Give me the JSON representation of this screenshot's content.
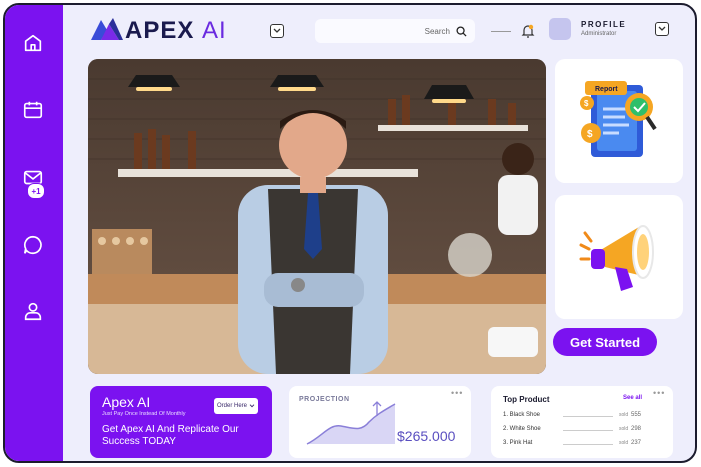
{
  "brand": {
    "name": "APEX",
    "suffix": "AI"
  },
  "header": {
    "search_placeholder": "Search",
    "profile_name": "PROFILE",
    "profile_role": "Administrator"
  },
  "sidebar": {
    "items": [
      {
        "name": "home",
        "icon": "home-icon"
      },
      {
        "name": "calendar",
        "icon": "calendar-icon"
      },
      {
        "name": "messages",
        "icon": "mail-icon",
        "badge": "+1"
      },
      {
        "name": "chat",
        "icon": "chat-icon"
      },
      {
        "name": "user",
        "icon": "user-icon"
      }
    ]
  },
  "cta": {
    "get_started": "Get Started"
  },
  "promo": {
    "title": "Apex AI",
    "subtitle": "Just Pay Once Instead Of Monthly",
    "order_button": "Order Here",
    "cta_text": "Get Apex AI And Replicate Our Success TODAY"
  },
  "projection": {
    "label": "PROJECTION",
    "value": "$265.000"
  },
  "top_product": {
    "title": "Top Product",
    "see_all": "See all",
    "sold_label": "sold",
    "items": [
      {
        "name": "1. Black Shoe",
        "count": "555"
      },
      {
        "name": "2. White Shoe",
        "count": "298"
      },
      {
        "name": "3. Pink Hat",
        "count": "237"
      }
    ]
  },
  "colors": {
    "accent": "#7b12f0",
    "background": "#eeeefc",
    "text": "#1a1a4e"
  }
}
